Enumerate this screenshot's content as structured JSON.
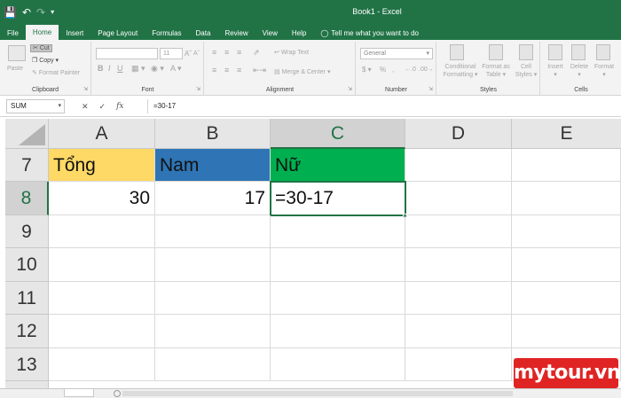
{
  "window": {
    "title": "Book1 - Excel"
  },
  "qat": {
    "save_icon": "save-icon",
    "undo_icon": "undo-icon",
    "redo_icon": "redo-icon",
    "customize_icon": "customize-icon"
  },
  "tabs": [
    {
      "label": "File"
    },
    {
      "label": "Home"
    },
    {
      "label": "Insert"
    },
    {
      "label": "Page Layout"
    },
    {
      "label": "Formulas"
    },
    {
      "label": "Data"
    },
    {
      "label": "Review"
    },
    {
      "label": "View"
    },
    {
      "label": "Help"
    }
  ],
  "tell_me": "Tell me what you want to do",
  "ribbon": {
    "clipboard": {
      "paste": "Paste",
      "cut": "Cut",
      "copy": "Copy",
      "format_painter": "Format Painter",
      "label": "Clipboard"
    },
    "font": {
      "size": "11",
      "bold": "B",
      "italic": "I",
      "underline": "U",
      "label": "Font"
    },
    "alignment": {
      "wrap_text": "Wrap Text",
      "merge": "Merge & Center",
      "label": "Alignment"
    },
    "number": {
      "format": "General",
      "label": "Number"
    },
    "styles": {
      "conditional_l1": "Conditional",
      "conditional_l2": "Formatting",
      "table_l1": "Format as",
      "table_l2": "Table",
      "cell_l1": "Cell",
      "cell_l2": "Styles",
      "label": "Styles"
    },
    "cells": {
      "insert": "Insert",
      "delete": "Delete",
      "format": "Format",
      "label": "Cells"
    }
  },
  "formula_bar": {
    "name_box": "SUM",
    "cancel": "✕",
    "enter": "✓",
    "fx": "fx",
    "value": "=30-17"
  },
  "columns": [
    "A",
    "B",
    "C",
    "D",
    "E"
  ],
  "rows": [
    {
      "num": "7",
      "cells": [
        "Tổng",
        "Nam",
        "Nữ",
        "",
        ""
      ]
    },
    {
      "num": "8",
      "cells": [
        "30",
        "17",
        "=30-17",
        "",
        ""
      ]
    },
    {
      "num": "9",
      "cells": [
        "",
        "",
        "",
        "",
        ""
      ]
    },
    {
      "num": "10",
      "cells": [
        "",
        "",
        "",
        "",
        ""
      ]
    },
    {
      "num": "11",
      "cells": [
        "",
        "",
        "",
        "",
        ""
      ]
    },
    {
      "num": "12",
      "cells": [
        "",
        "",
        "",
        "",
        ""
      ]
    },
    {
      "num": "13",
      "cells": [
        "",
        "",
        "",
        "",
        ""
      ]
    }
  ],
  "header_colors": {
    "A": "#ffd966",
    "B": "#2f75b5",
    "C": "#00b050"
  },
  "accent": "#217346",
  "watermark": "mytour.vn"
}
